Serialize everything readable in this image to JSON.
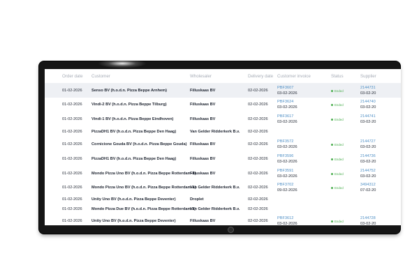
{
  "table": {
    "headers": {
      "order_date": "Order date",
      "customer": "Customer",
      "wholesaler": "Wholesaler",
      "delivery_date": "Delivery date",
      "customer_invoice": "Customer invoice",
      "status": "Status",
      "supplier": "Supplier"
    },
    "rows": [
      {
        "order_date": "01-02-2026",
        "customer": "Senso BV (h.o.d.n. Pizza Beppe Arnhem)",
        "wholesaler": "Filluskaas BV",
        "delivery_date": "02-02-2026",
        "invoice_no": "PBF3607",
        "invoice_date": "03-02-2026",
        "status": "Ended",
        "supplier_no": "2144731",
        "supplier_date": "03-02-20"
      },
      {
        "order_date": "01-02-2026",
        "customer": "Vindi-2 BV (h.o.d.n. Pizza Beppe Tilburg)",
        "wholesaler": "Filluskaas BV",
        "delivery_date": "02-02-2026",
        "invoice_no": "PBF3624",
        "invoice_date": "03-02-2026",
        "status": "Ended",
        "supplier_no": "2144740",
        "supplier_date": "03-02-20"
      },
      {
        "order_date": "01-02-2026",
        "customer": "Vindi-1 BV (h.o.d.n. Pizza Beppe Eindhoven)",
        "wholesaler": "Filluskaas BV",
        "delivery_date": "02-02-2026",
        "invoice_no": "PBF3617",
        "invoice_date": "03-02-2026",
        "status": "Ended",
        "supplier_no": "2144741",
        "supplier_date": "03-02-20"
      },
      {
        "order_date": "01-02-2026",
        "customer": "PizzaDH1 BV (h.o.d.n. Pizza Beppe Den Haag)",
        "wholesaler": "Van Gelder Ridderkerk B.v.",
        "delivery_date": "02-02-2026",
        "invoice_no": "",
        "invoice_date": "",
        "status": "",
        "supplier_no": "",
        "supplier_date": ""
      },
      {
        "order_date": "01-02-2026",
        "customer": "Cornicione Gouda BV (h.o.d.n. Pizza Beppe Gouda)",
        "wholesaler": "Filluskaas BV",
        "delivery_date": "02-02-2026",
        "invoice_no": "PBF3572",
        "invoice_date": "03-02-2026",
        "status": "Ended",
        "supplier_no": "2144727",
        "supplier_date": "03-02-20"
      },
      {
        "order_date": "01-02-2026",
        "customer": "PizzaDH1 BV (h.o.d.n. Pizza Beppe Den Haag)",
        "wholesaler": "Filluskaas BV",
        "delivery_date": "02-02-2026",
        "invoice_no": "PBF3596",
        "invoice_date": "03-02-2026",
        "status": "Ended",
        "supplier_no": "2144736",
        "supplier_date": "03-02-20"
      },
      {
        "order_date": "01-02-2026",
        "customer": "Mondo Pizza Uno BV (h.o.d.n. Pizza Beppe Rotterdam-1)",
        "wholesaler": "Filluskaas BV",
        "delivery_date": "02-02-2026",
        "invoice_no": "PBF3591",
        "invoice_date": "03-02-2026",
        "status": "Ended",
        "supplier_no": "2144752",
        "supplier_date": "03-02-20"
      },
      {
        "order_date": "01-02-2026",
        "customer": "Mondo Pizza Uno BV (h.o.d.n. Pizza Beppe Rotterdam-1)",
        "wholesaler": "Van Gelder Ridderkerk B.v.",
        "delivery_date": "02-02-2026",
        "invoice_no": "PBF3702",
        "invoice_date": "09-02-2026",
        "status": "Ended",
        "supplier_no": "3494312",
        "supplier_date": "07-02-20"
      },
      {
        "order_date": "01-02-2026",
        "customer": "Unity Uno BV (h.o.d.n. Pizza Beppe Deventer)",
        "wholesaler": "Droplet",
        "delivery_date": "02-02-2026",
        "invoice_no": "",
        "invoice_date": "",
        "status": "",
        "supplier_no": "",
        "supplier_date": ""
      },
      {
        "order_date": "01-02-2026",
        "customer": "Mondo Pizza Due BV (h.o.d.n. Pizza Beppe Rotterdam-2)",
        "wholesaler": "Van Gelder Ridderkerk B.v.",
        "delivery_date": "02-02-2026",
        "invoice_no": "",
        "invoice_date": "",
        "status": "",
        "supplier_no": "",
        "supplier_date": ""
      },
      {
        "order_date": "01-02-2026",
        "customer": "Unity Uno BV (h.o.d.n. Pizza Beppe Deventer)",
        "wholesaler": "Filluskaas BV",
        "delivery_date": "02-02-2026",
        "invoice_no": "PBF3612",
        "invoice_date": "03-02-2026",
        "status": "Ended",
        "supplier_no": "2144728",
        "supplier_date": "03-02-20"
      }
    ]
  }
}
